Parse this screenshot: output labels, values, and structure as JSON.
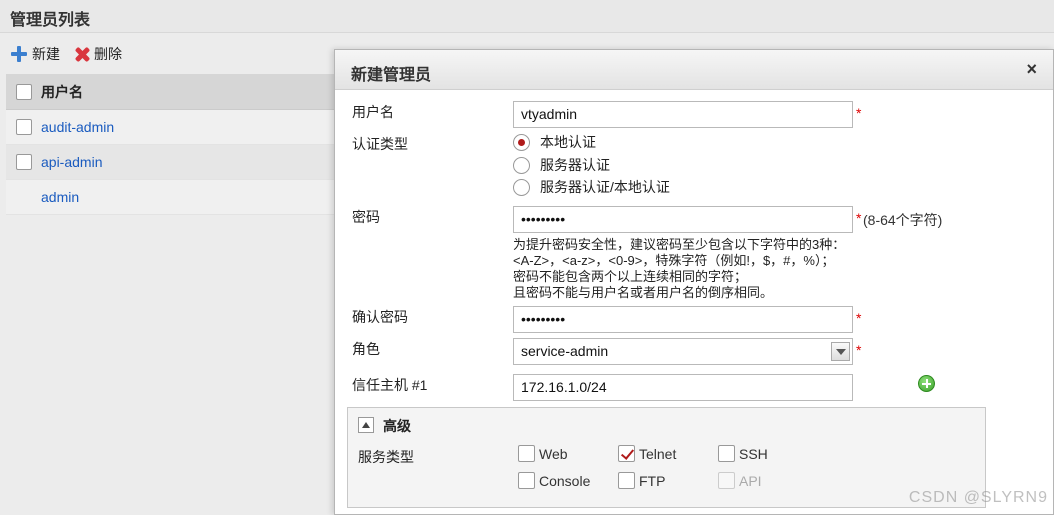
{
  "page": {
    "title": "管理员列表",
    "toolbar": {
      "new_label": "新建",
      "delete_label": "删除"
    },
    "grid": {
      "header": "用户名",
      "rows": [
        "audit-admin",
        "api-admin",
        "admin"
      ]
    }
  },
  "dialog": {
    "title": "新建管理员",
    "close": "×",
    "username": {
      "label": "用户名",
      "value": "vtyadmin",
      "required": "*"
    },
    "auth_type": {
      "label": "认证类型",
      "options": [
        "本地认证",
        "服务器认证",
        "服务器认证/本地认证"
      ],
      "selected": "本地认证"
    },
    "password": {
      "label": "密码",
      "value": "•••••••••",
      "required": "*",
      "length_hint": "(8-64个字符)"
    },
    "password_hint": [
      "为提升密码安全性，建议密码至少包含以下字符中的3种：",
      "<A-Z>，<a-z>，<0-9>，特殊字符（例如!，$，#，%）；",
      "密码不能包含两个以上连续相同的字符；",
      "且密码不能与用户名或者用户名的倒序相同。"
    ],
    "confirm_password": {
      "label": "确认密码",
      "value": "•••••••••",
      "required": "*"
    },
    "role": {
      "label": "角色",
      "value": "service-admin",
      "required": "*"
    },
    "trusted_host": {
      "label": "信任主机 #1",
      "value": "172.16.1.0/24"
    },
    "advanced": {
      "title": "高级",
      "service_label": "服务类型",
      "services": [
        {
          "name": "Web",
          "checked": false,
          "disabled": false
        },
        {
          "name": "Telnet",
          "checked": true,
          "disabled": false
        },
        {
          "name": "SSH",
          "checked": false,
          "disabled": false
        },
        {
          "name": "Console",
          "checked": false,
          "disabled": false
        },
        {
          "name": "FTP",
          "checked": false,
          "disabled": false
        },
        {
          "name": "API",
          "checked": false,
          "disabled": true
        }
      ]
    }
  },
  "watermark": "CSDN @SLYRN9"
}
